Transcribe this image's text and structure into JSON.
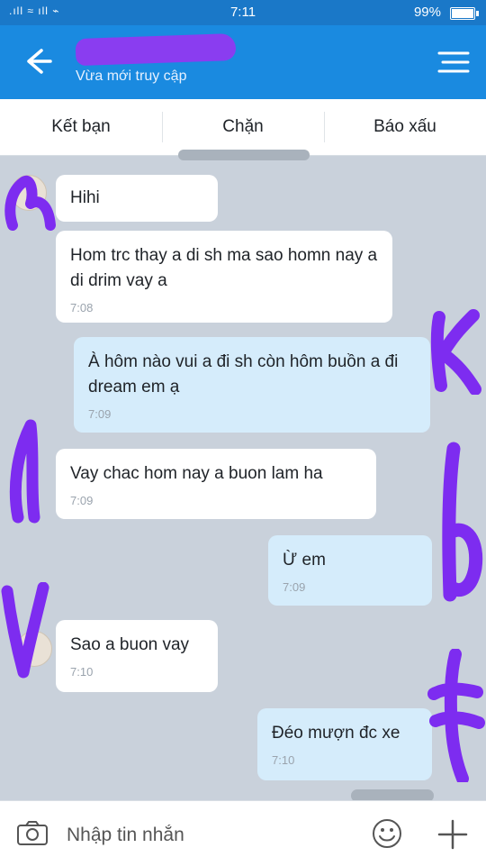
{
  "status": {
    "time": "7:11",
    "battery": "99%",
    "signal": ".ıll ≈ ıll ⌁"
  },
  "header": {
    "subtitle": "Vừa mới truy cập",
    "back_icon": "arrow-left-icon",
    "menu_icon": "menu-icon",
    "accent": "#1a8ae0"
  },
  "actions": {
    "add_friend": "Kết bạn",
    "block": "Chặn",
    "report": "Báo xấu"
  },
  "messages": [
    {
      "dir": "in",
      "text": "Hihi",
      "time": ""
    },
    {
      "dir": "in",
      "text": "Hom trc thay a di sh ma sao homn nay a di drim vay a",
      "time": "7:08"
    },
    {
      "dir": "out",
      "text": "À hôm nào vui a đi sh còn hôm buồn a đi dream em ạ",
      "time": "7:09"
    },
    {
      "dir": "in",
      "text": "Vay chac hom nay a buon lam ha",
      "time": "7:09"
    },
    {
      "dir": "out",
      "text": "Ừ em",
      "time": "7:09"
    },
    {
      "dir": "in",
      "text": "Sao a buon vay",
      "time": "7:10"
    },
    {
      "dir": "out",
      "text": "Đéo mượn đc xe",
      "time": "7:10"
    }
  ],
  "composer": {
    "placeholder": "Nhập tin nhắn",
    "camera_icon": "camera-icon",
    "emoji_icon": "emoji-icon",
    "plus_icon": "plus-icon"
  },
  "colors": {
    "incoming": "#ffffff",
    "outgoing": "#d5ecfb",
    "background": "#c9d1db",
    "redaction": "#8a3df0"
  }
}
